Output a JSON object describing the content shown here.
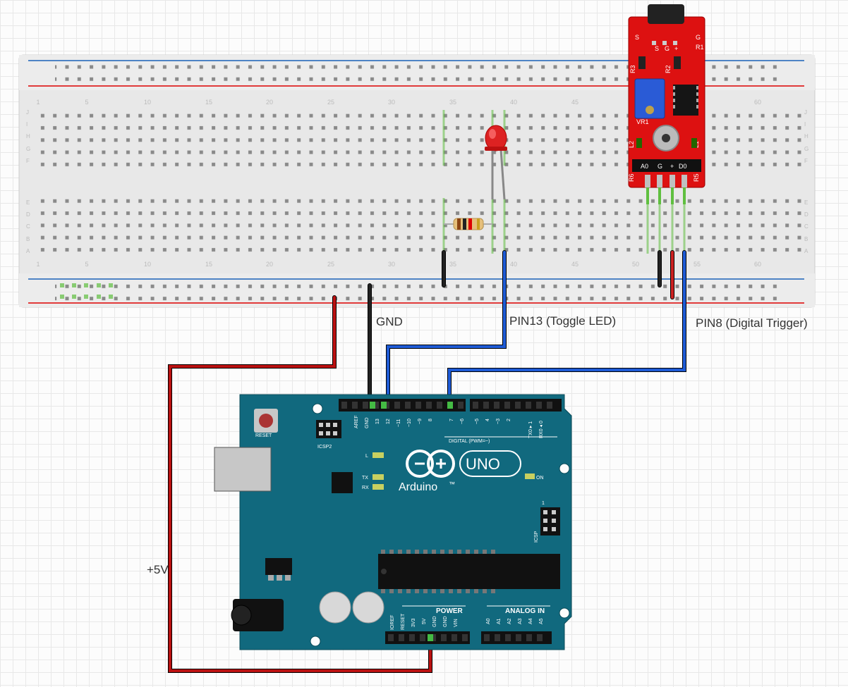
{
  "labels": {
    "gnd": "GND",
    "pin13": "PIN13 (Toggle LED)",
    "pin8": "PIN8 (Digital Trigger)",
    "v5": "+5V"
  },
  "arduino": {
    "brand": "Arduino",
    "trademark": "™",
    "model": "UNO",
    "reset": "RESET",
    "icsp2": "ICSP2",
    "icsp": "ICSP",
    "aref": "AREF",
    "gnd": "GND",
    "digital_label": "DIGITAL (PWM=~)",
    "power_label": "POWER",
    "analog_label": "ANALOG IN",
    "L": "L",
    "TX": "TX",
    "RX": "RX",
    "ON": "ON",
    "TX0": "TX0 ▸ 1",
    "RX0": "RX0 ◂ 0",
    "digital_pins": [
      "13",
      "12",
      "~11",
      "~10",
      "~9",
      "8",
      "7",
      "~6",
      "~5",
      "4",
      "~3",
      "2"
    ],
    "power_pins": [
      "IOREF",
      "RESET",
      "3V3",
      "5V",
      "GND",
      "GND",
      "VIN"
    ],
    "analog_pins": [
      "A0",
      "A1",
      "A2",
      "A3",
      "A4",
      "A5"
    ],
    "icspOne": "1"
  },
  "module": {
    "S": "S",
    "G": "G",
    "R1": "R1",
    "R2": "R2",
    "R3": "R3",
    "R5": "R5",
    "R6": "R6",
    "L1": "L1",
    "L2": "L2",
    "VR1": "VR1",
    "A0": "A0",
    "Gpin": "G",
    "plus": "+",
    "D0": "D0",
    "Smid": "S",
    "Gmid": "G",
    "plusmid": "+"
  },
  "breadboard": {
    "column_numbers": [
      "1",
      "5",
      "10",
      "15",
      "20",
      "25",
      "30",
      "35",
      "40",
      "45",
      "50",
      "55",
      "60"
    ],
    "row_letters_top": [
      "J",
      "I",
      "H",
      "G",
      "F"
    ],
    "row_letters_bottom": [
      "E",
      "D",
      "C",
      "B",
      "A"
    ]
  }
}
